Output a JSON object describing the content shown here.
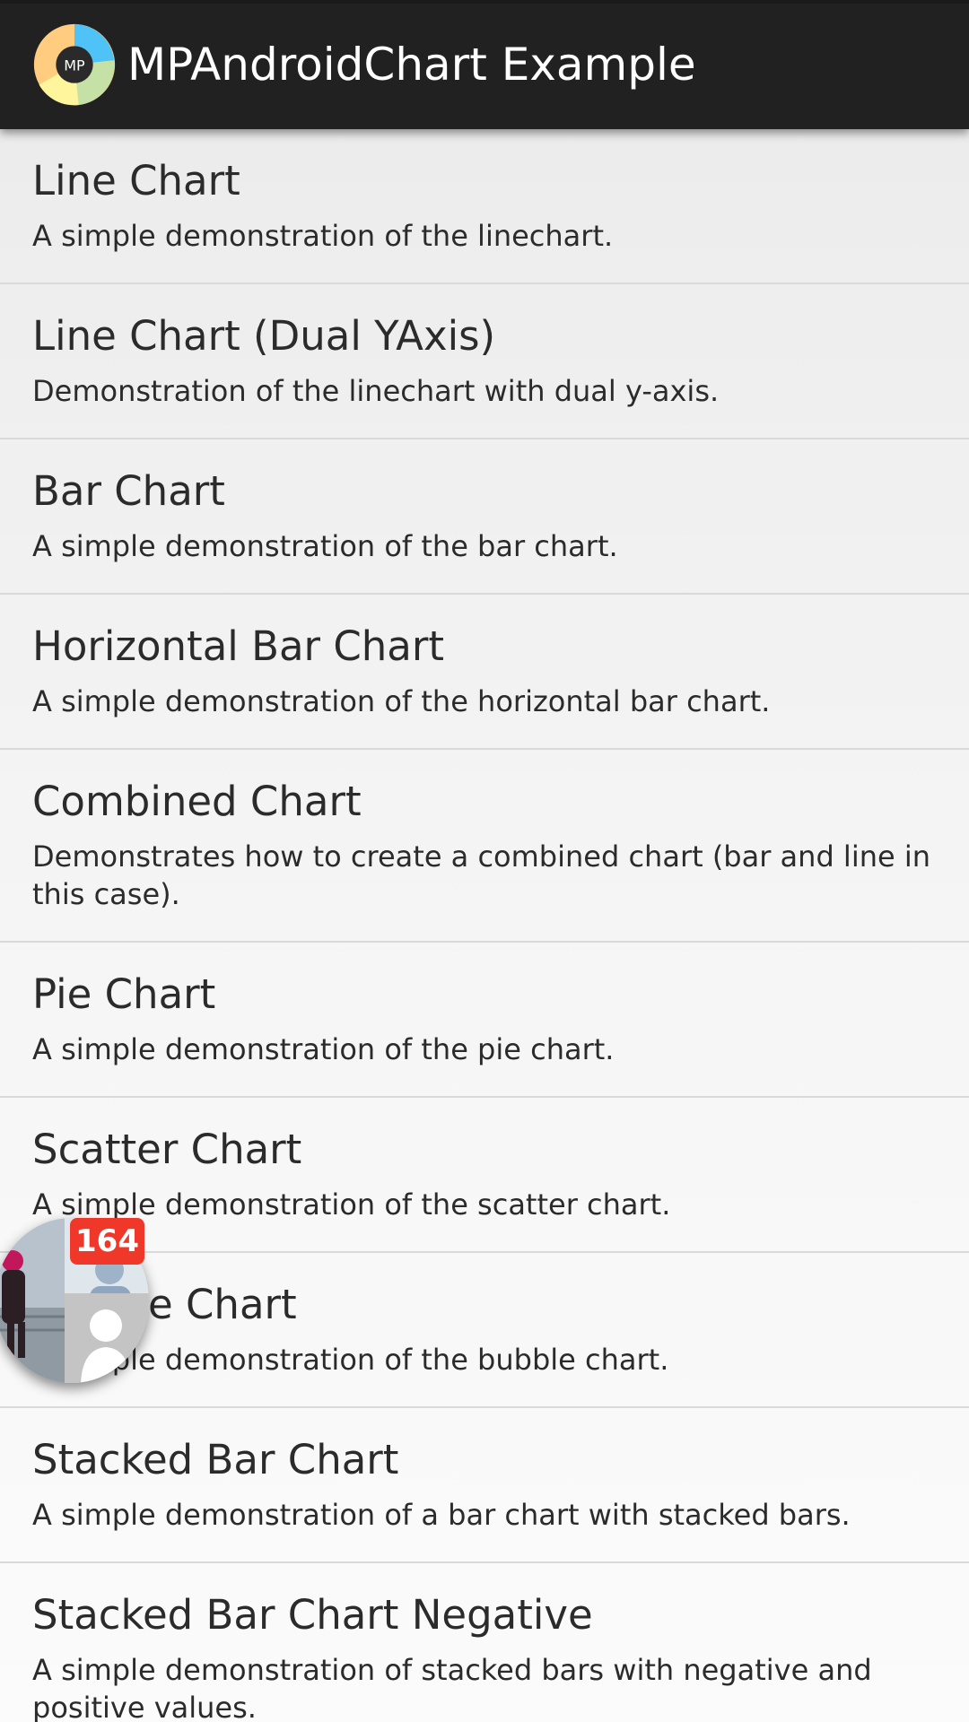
{
  "app": {
    "title": "MPAndroidChart Example",
    "logo_text": "MP",
    "logo_colors": [
      "#4fc3f7",
      "#c5e1a5",
      "#fff59d",
      "#ffcc80"
    ]
  },
  "list": {
    "items": [
      {
        "title": "Line Chart",
        "description": "A simple demonstration of the linechart."
      },
      {
        "title": "Line Chart (Dual YAxis)",
        "description": "Demonstration of the linechart with dual y-axis."
      },
      {
        "title": "Bar Chart",
        "description": "A simple demonstration of the bar chart."
      },
      {
        "title": "Horizontal Bar Chart",
        "description": "A simple demonstration of the horizontal bar chart."
      },
      {
        "title": "Combined Chart",
        "description": "Demonstrates how to create a combined chart (bar and line in this case)."
      },
      {
        "title": "Pie Chart",
        "description": "A simple demonstration of the pie chart."
      },
      {
        "title": "Scatter Chart",
        "description": "A simple demonstration of the scatter chart."
      },
      {
        "title": "Bubble Chart",
        "description": "A simple demonstration of the bubble chart."
      },
      {
        "title": "Stacked Bar Chart",
        "description": "A simple demonstration of a bar chart with stacked bars."
      },
      {
        "title": "Stacked Bar Chart Negative",
        "description": "A simple demonstration of stacked bars with negative and positive values."
      }
    ]
  },
  "chat_head": {
    "badge_count": "164",
    "badge_color": "#f0382a"
  }
}
